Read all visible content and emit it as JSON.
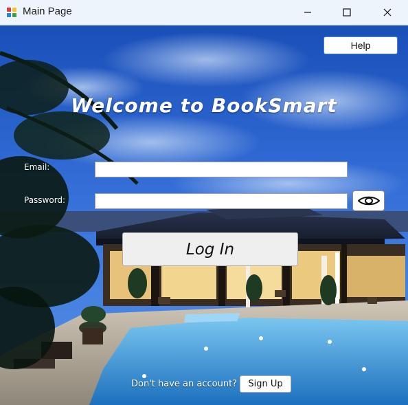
{
  "window": {
    "title": "Main Page",
    "icon": "app-form-icon",
    "controls": {
      "minimize": "minimize-icon",
      "maximize": "maximize-icon",
      "close": "close-icon"
    }
  },
  "header": {
    "help_label": "Help"
  },
  "main": {
    "welcome": "Welcome to BookSmart",
    "email_label": "Email:",
    "email_value": "",
    "password_label": "Password:",
    "password_value": "",
    "show_password_icon": "eye-icon",
    "login_label": "Log In"
  },
  "footer": {
    "no_account_text": "Don't have an account?",
    "signup_label": "Sign Up"
  },
  "colors": {
    "sky_top": "#1a4fb8",
    "sky_mid": "#3f7be0",
    "pool": "#2f8fd4",
    "help_border": "#4a7fd8",
    "titlebar_bg": "#eef4fb"
  }
}
